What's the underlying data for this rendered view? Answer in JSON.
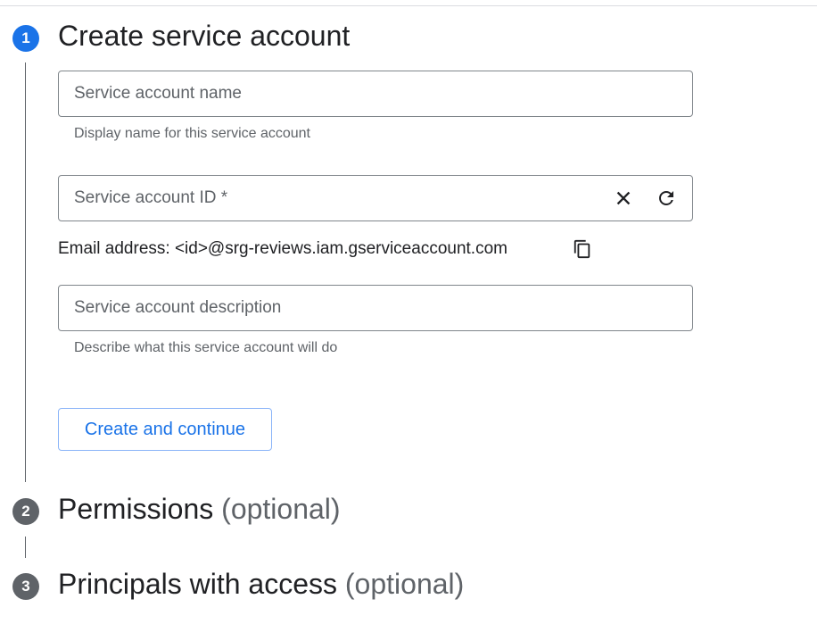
{
  "steps": [
    {
      "number": "1",
      "title": "Create service account",
      "optional": ""
    },
    {
      "number": "2",
      "title": "Permissions",
      "optional": "(optional)"
    },
    {
      "number": "3",
      "title": "Principals with access",
      "optional": "(optional)"
    }
  ],
  "form": {
    "name": {
      "placeholder": "Service account name",
      "value": "",
      "hint": "Display name for this service account"
    },
    "id": {
      "placeholder": "Service account ID *",
      "value": ""
    },
    "email": {
      "label": "Email address: <id>@srg-reviews.iam.gserviceaccount.com"
    },
    "description": {
      "placeholder": "Service account description",
      "value": "",
      "hint": "Describe what this service account will do"
    },
    "submit_label": "Create and continue"
  },
  "icons": {
    "clear": "close-icon",
    "regenerate": "refresh-icon",
    "copy": "copy-icon"
  },
  "colors": {
    "accent": "#1a73e8",
    "step_inactive": "#5f6368",
    "border": "#80868b"
  }
}
